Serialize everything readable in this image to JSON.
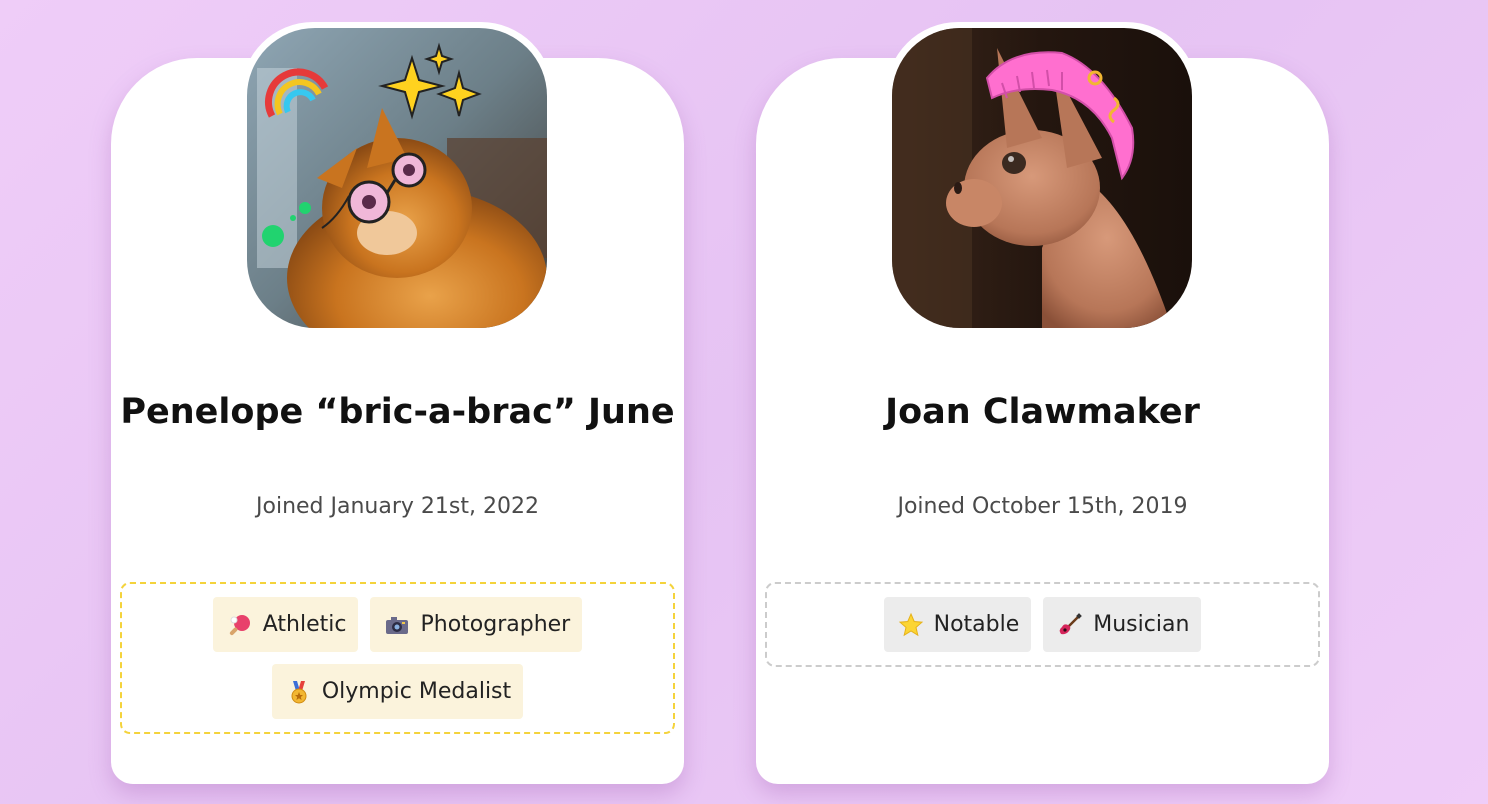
{
  "cards": [
    {
      "name": "Penelope “bric-a-brac” June",
      "joined": "Joined January 21st, 2022",
      "badges": [
        {
          "label": "Athletic",
          "icon": "ping-pong-icon"
        },
        {
          "label": "Photographer",
          "icon": "camera-icon"
        },
        {
          "label": "Olympic Medalist",
          "icon": "medal-icon"
        }
      ],
      "badge_border_color": "#f4d33c"
    },
    {
      "name": "Joan Clawmaker",
      "joined": "Joined October 15th, 2019",
      "badges": [
        {
          "label": "Notable",
          "icon": "star-icon"
        },
        {
          "label": "Musician",
          "icon": "guitar-icon"
        }
      ],
      "badge_border_color": "#cccccc"
    }
  ],
  "colors": {
    "background": "#ecc8f6",
    "card": "#ffffff",
    "gold_border": "#f4d33c",
    "gold_badge_bg": "#fbf3dc",
    "gray_badge_bg": "#ececec"
  }
}
